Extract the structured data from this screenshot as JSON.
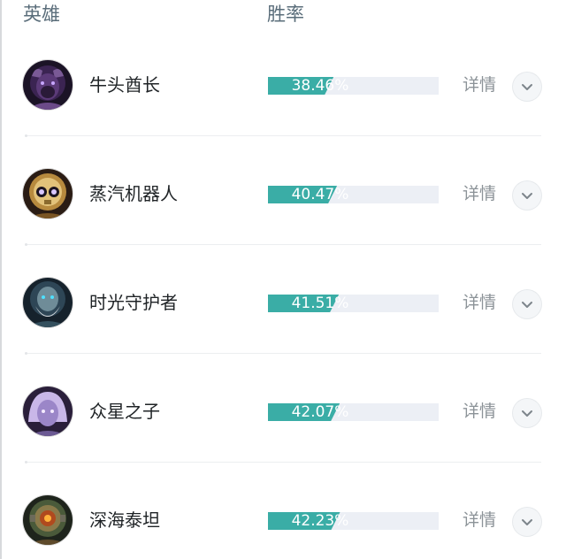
{
  "header": {
    "hero_col": "英雄",
    "rate_col": "胜率"
  },
  "detail_label": "详情",
  "accent_color": "#3aada6",
  "track_color": "#eceff5",
  "heroes": [
    {
      "name": "牛头酋长",
      "win_rate": "38.46%",
      "win_rate_value": 38.46,
      "avatar_icon": "minotaur-chief-avatar"
    },
    {
      "name": "蒸汽机器人",
      "win_rate": "40.47%",
      "win_rate_value": 40.47,
      "avatar_icon": "steam-robot-avatar"
    },
    {
      "name": "时光守护者",
      "win_rate": "41.51%",
      "win_rate_value": 41.51,
      "avatar_icon": "time-guardian-avatar"
    },
    {
      "name": "众星之子",
      "win_rate": "42.07%",
      "win_rate_value": 42.07,
      "avatar_icon": "star-child-avatar"
    },
    {
      "name": "深海泰坦",
      "win_rate": "42.23%",
      "win_rate_value": 42.23,
      "avatar_icon": "deep-sea-titan-avatar"
    }
  ]
}
